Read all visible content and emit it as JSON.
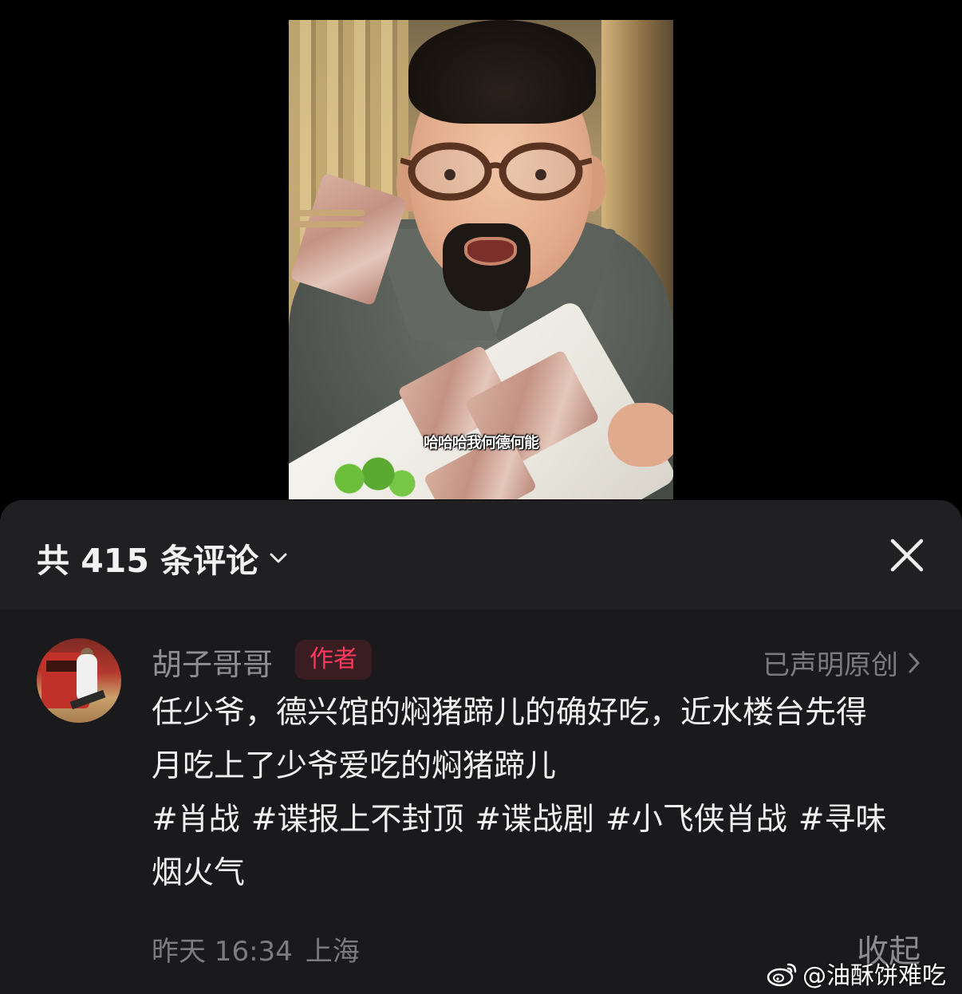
{
  "video": {
    "subtitle": "哈哈哈我何德何能"
  },
  "comments_header": {
    "title": "共 415 条评论",
    "dropdown_icon": "chevron-down-icon",
    "close_icon": "close-icon"
  },
  "comment": {
    "username": "胡子哥哥",
    "badge": "作者",
    "original_label": "已声明原创",
    "body_lines": [
      "任少爷，德兴馆的焖猪蹄儿的确好吃，近水楼台先得",
      "月吃上了少爷爱吃的焖猪蹄儿"
    ],
    "tags": [
      "#肖战",
      "#谍报上不封顶",
      "#谍战剧",
      "#小飞侠肖战",
      "#寻味"
    ],
    "tags_wrap": "烟火气",
    "time": "昨天 16:34",
    "location": "上海",
    "collapse_label": "收起"
  },
  "watermark": {
    "text": "@油酥饼难吃",
    "icon": "weibo-icon"
  },
  "colors": {
    "background": "#000000",
    "sheet": "#1a1a1c",
    "sheet_header": "#202023",
    "badge_text": "#ff3b5c",
    "badge_bg": "#3a1c23",
    "muted_text": "#7b7b80"
  }
}
